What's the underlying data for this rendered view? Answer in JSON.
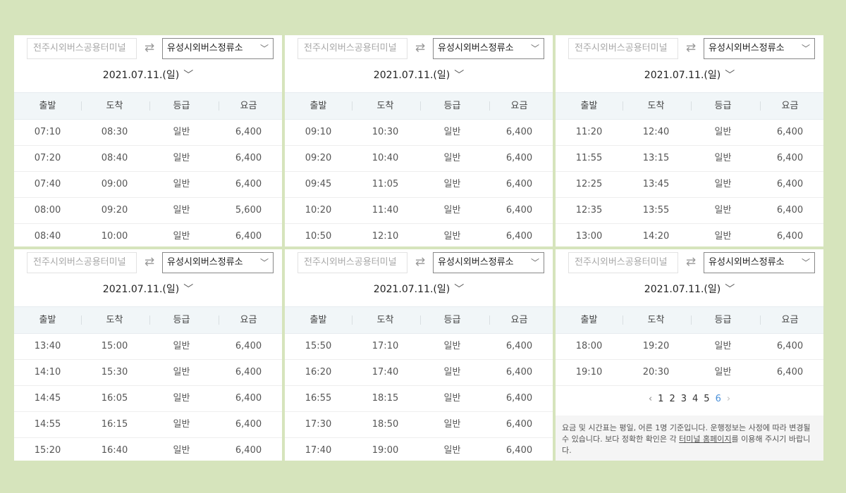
{
  "route": {
    "origin": "전주시외버스공용터미널",
    "destination": "유성시외버스정류소",
    "swap_icon": "⇄",
    "dropdown_icon": "chevron-down-icon"
  },
  "date": "2021.07.11.(일)",
  "columns": [
    "출발",
    "도착",
    "등급",
    "요금"
  ],
  "panels": [
    {
      "rows": [
        [
          "07:10",
          "08:30",
          "일반",
          "6,400"
        ],
        [
          "07:20",
          "08:40",
          "일반",
          "6,400"
        ],
        [
          "07:40",
          "09:00",
          "일반",
          "6,400"
        ],
        [
          "08:00",
          "09:20",
          "일반",
          "5,600"
        ],
        [
          "08:40",
          "10:00",
          "일반",
          "6,400"
        ]
      ]
    },
    {
      "rows": [
        [
          "09:10",
          "10:30",
          "일반",
          "6,400"
        ],
        [
          "09:20",
          "10:40",
          "일반",
          "6,400"
        ],
        [
          "09:45",
          "11:05",
          "일반",
          "6,400"
        ],
        [
          "10:20",
          "11:40",
          "일반",
          "6,400"
        ],
        [
          "10:50",
          "12:10",
          "일반",
          "6,400"
        ]
      ]
    },
    {
      "rows": [
        [
          "11:20",
          "12:40",
          "일반",
          "6,400"
        ],
        [
          "11:55",
          "13:15",
          "일반",
          "6,400"
        ],
        [
          "12:25",
          "13:45",
          "일반",
          "6,400"
        ],
        [
          "12:35",
          "13:55",
          "일반",
          "6,400"
        ],
        [
          "13:00",
          "14:20",
          "일반",
          "6,400"
        ]
      ]
    },
    {
      "rows": [
        [
          "13:40",
          "15:00",
          "일반",
          "6,400"
        ],
        [
          "14:10",
          "15:30",
          "일반",
          "6,400"
        ],
        [
          "14:45",
          "16:05",
          "일반",
          "6,400"
        ],
        [
          "14:55",
          "16:15",
          "일반",
          "6,400"
        ],
        [
          "15:20",
          "16:40",
          "일반",
          "6,400"
        ]
      ]
    },
    {
      "rows": [
        [
          "15:50",
          "17:10",
          "일반",
          "6,400"
        ],
        [
          "16:20",
          "17:40",
          "일반",
          "6,400"
        ],
        [
          "16:55",
          "18:15",
          "일반",
          "6,400"
        ],
        [
          "17:30",
          "18:50",
          "일반",
          "6,400"
        ],
        [
          "17:40",
          "19:00",
          "일반",
          "6,400"
        ]
      ]
    },
    {
      "rows": [
        [
          "18:00",
          "19:20",
          "일반",
          "6,400"
        ],
        [
          "19:10",
          "20:30",
          "일반",
          "6,400"
        ]
      ]
    }
  ],
  "pagination": {
    "prev": "‹",
    "next": "›",
    "pages": [
      "1",
      "2",
      "3",
      "4",
      "5",
      "6"
    ],
    "current": "6"
  },
  "notice": {
    "text_before": "요금 및 시간표는 평일, 어른 1명 기준입니다. 운행정보는 사정에 따라 변경될 수 있습니다. 보다 정확한 확인은 각 ",
    "link": "터미널 홈페이지",
    "text_after": "를 이용해 주시기 바랍니다."
  },
  "colors": {
    "background": "#d6e4bc",
    "header_bg": "#f1f6f8",
    "active_page": "#4a90d9"
  }
}
